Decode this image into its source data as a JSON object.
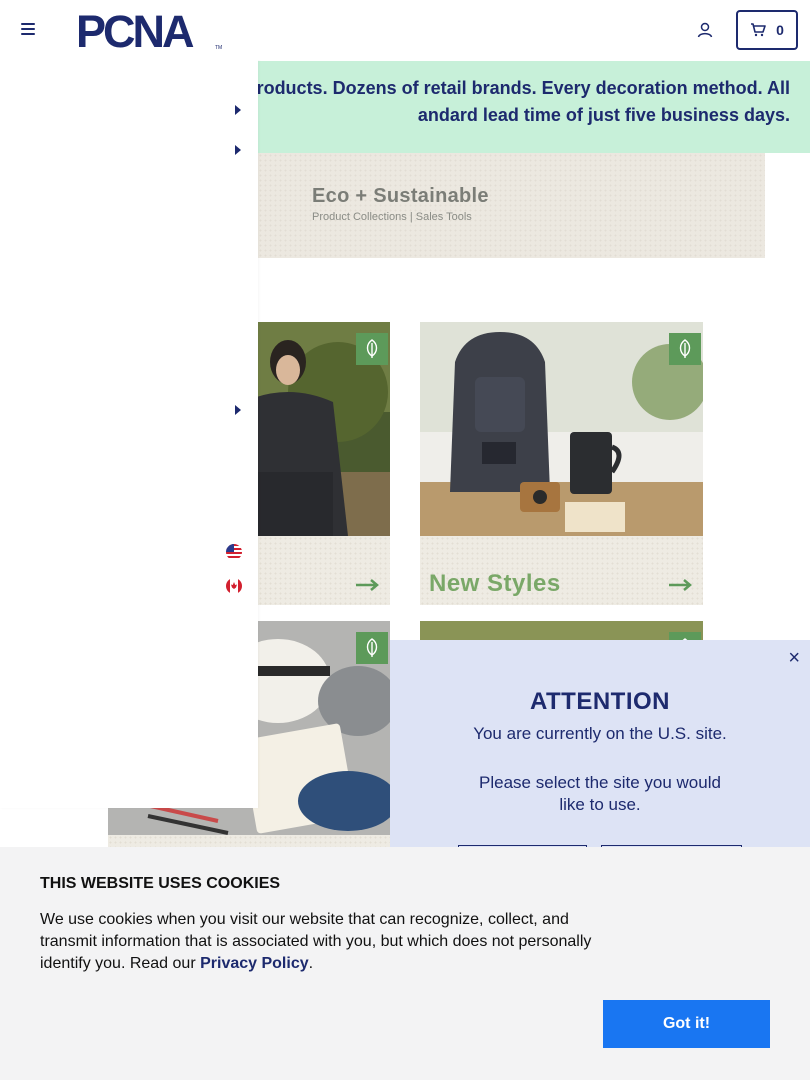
{
  "header": {
    "logo_text": "PCNA",
    "logo_tm": "TM",
    "cart_count": "0"
  },
  "banner": {
    "line1": "roducts. Dozens of retail brands. Every decoration method. All",
    "line2": "andard lead time of just five business days."
  },
  "eco_banner": {
    "title": "Eco + Sustainable",
    "subtitle": "Product Collections  |  Sales Tools"
  },
  "tiles": {
    "new_styles_label": "New Styles"
  },
  "modal": {
    "close_label": "×",
    "title": "ATTENTION",
    "line1": "You are currently on the U.S. site.",
    "line2": "Please select the site you would like to use."
  },
  "cookie": {
    "title": "THIS WEBSITE USES COOKIES",
    "body": "We use cookies when you visit our website that can recognize, collect, and transmit information that is associated with you, but which does not personally identify you. Read our ",
    "link": "Privacy Policy",
    "period": ".",
    "button": "Got it!"
  },
  "colors": {
    "navy": "#1d2a6e",
    "banner_green": "#c7f0d9",
    "leaf_green": "#5d9a5a",
    "cookie_button": "#1976f2"
  },
  "icons": [
    "hamburger-icon",
    "user-icon",
    "cart-icon",
    "leaf-icon",
    "arrow-right-icon",
    "caret-right-icon",
    "us-flag-icon",
    "canada-flag-icon",
    "close-icon"
  ]
}
